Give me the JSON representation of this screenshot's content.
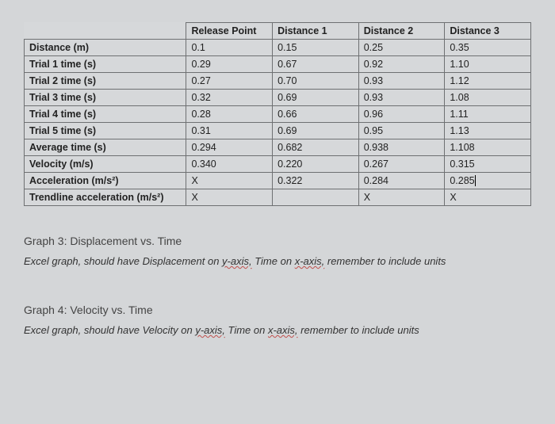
{
  "table": {
    "headers": [
      "Release Point",
      "Distance 1",
      "Distance 2",
      "Distance 3"
    ],
    "rows": [
      {
        "label": "Distance (m)",
        "values": [
          "0.1",
          "0.15",
          "0.25",
          "0.35"
        ]
      },
      {
        "label": "Trial 1 time (s)",
        "values": [
          "0.29",
          "0.67",
          "0.92",
          "1.10"
        ]
      },
      {
        "label": "Trial 2 time (s)",
        "values": [
          "0.27",
          "0.70",
          "0.93",
          "1.12"
        ]
      },
      {
        "label": "Trial 3 time (s)",
        "values": [
          "0.32",
          "0.69",
          "0.93",
          "1.08"
        ]
      },
      {
        "label": "Trial 4 time (s)",
        "values": [
          "0.28",
          "0.66",
          "0.96",
          "1.11"
        ]
      },
      {
        "label": "Trial 5 time (s)",
        "values": [
          "0.31",
          "0.69",
          "0.95",
          "1.13"
        ]
      },
      {
        "label": "Average time (s)",
        "values": [
          "0.294",
          "0.682",
          "0.938",
          "1.108"
        ]
      },
      {
        "label": "Velocity (m/s)",
        "values": [
          "0.340",
          "0.220",
          "0.267",
          "0.315"
        ]
      },
      {
        "label": "Acceleration (m/s²)",
        "values": [
          "X",
          "0.322",
          "0.284",
          "0.285"
        ]
      },
      {
        "label": "Trendline acceleration (m/s²)",
        "values": [
          "X",
          "",
          "X",
          "X"
        ]
      }
    ]
  },
  "graph3": {
    "title": "Graph 3: Displacement vs. Time",
    "note_pre": "Excel graph, should have Displacement on ",
    "yaxis": "y-axis,",
    "note_mid": " Time on ",
    "xaxis": "x-axis,",
    "note_post": " remember to include units"
  },
  "graph4": {
    "title": "Graph 4: Velocity vs. Time",
    "note_pre": "Excel graph, should have Velocity on ",
    "yaxis": "y-axis,",
    "note_mid": " Time on ",
    "xaxis": "x-axis,",
    "note_post": " remember to include units"
  },
  "chart_data": {
    "type": "table",
    "columns": [
      "Release Point",
      "Distance 1",
      "Distance 2",
      "Distance 3"
    ],
    "rows": {
      "Distance (m)": [
        0.1,
        0.15,
        0.25,
        0.35
      ],
      "Trial 1 time (s)": [
        0.29,
        0.67,
        0.92,
        1.1
      ],
      "Trial 2 time (s)": [
        0.27,
        0.7,
        0.93,
        1.12
      ],
      "Trial 3 time (s)": [
        0.32,
        0.69,
        0.93,
        1.08
      ],
      "Trial 4 time (s)": [
        0.28,
        0.66,
        0.96,
        1.11
      ],
      "Trial 5 time (s)": [
        0.31,
        0.69,
        0.95,
        1.13
      ],
      "Average time (s)": [
        0.294,
        0.682,
        0.938,
        1.108
      ],
      "Velocity (m/s)": [
        0.34,
        0.22,
        0.267,
        0.315
      ],
      "Acceleration (m/s^2)": [
        "X",
        0.322,
        0.284,
        0.285
      ],
      "Trendline acceleration (m/s^2)": [
        "X",
        "",
        "X",
        "X"
      ]
    }
  }
}
